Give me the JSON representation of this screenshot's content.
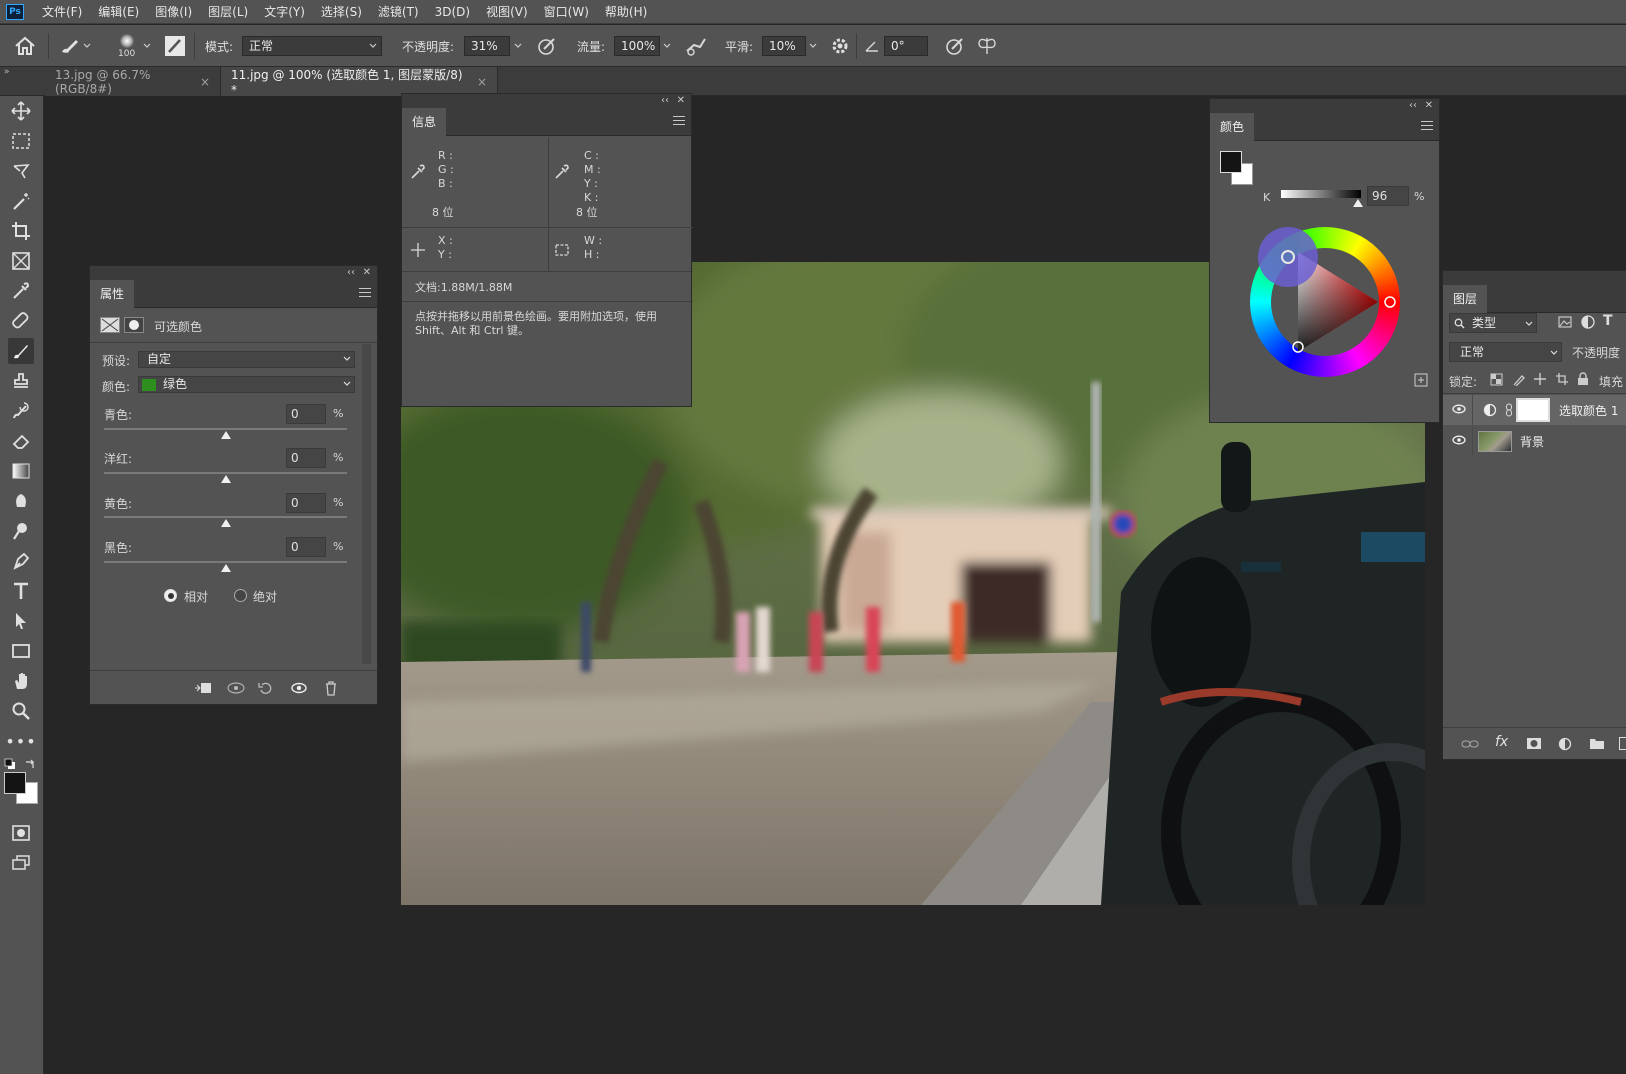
{
  "menubar": {
    "app_icon": "Ps",
    "items": [
      "文件(F)",
      "编辑(E)",
      "图像(I)",
      "图层(L)",
      "文字(Y)",
      "选择(S)",
      "滤镜(T)",
      "3D(D)",
      "视图(V)",
      "窗口(W)",
      "帮助(H)"
    ]
  },
  "options": {
    "brush_size": "100",
    "mode_label": "模式:",
    "mode_value": "正常",
    "opacity_label": "不透明度:",
    "opacity_value": "31%",
    "flow_label": "流量:",
    "flow_value": "100%",
    "smooth_label": "平滑:",
    "smooth_value": "10%",
    "angle_value": "0°"
  },
  "tabs": [
    {
      "label": "13.jpg @ 66.7%(RGB/8#)",
      "close": "×"
    },
    {
      "label": "11.jpg @ 100% (选取颜色 1, 图层蒙版/8) *",
      "close": "×"
    }
  ],
  "info_panel": {
    "title": "信息",
    "rgb_labels": [
      "R :",
      "G :",
      "B :"
    ],
    "cmyk_labels": [
      "C :",
      "M :",
      "Y :",
      "K :"
    ],
    "bits_left": "8 位",
    "bits_right": "8 位",
    "xy_labels": [
      "X :",
      "Y :"
    ],
    "wh_labels": [
      "W :",
      "H :"
    ],
    "doc_size": "文档:1.88M/1.88M",
    "hint": "点按并拖移以用前景色绘画。要用附加选项，使用 Shift、Alt 和 Ctrl 键。"
  },
  "color_panel": {
    "title": "颜色",
    "k_label": "K",
    "k_value": "96",
    "k_unit": "%",
    "foreground": "#141414",
    "background": "#ffffff"
  },
  "properties_panel": {
    "title": "属性",
    "subtitle": "可选颜色",
    "preset_label": "预设:",
    "preset_value": "自定",
    "color_label": "颜色:",
    "color_value": "绿色",
    "color_swatch": "#2e8f1e",
    "sliders": [
      {
        "label": "青色:",
        "value": "0",
        "unit": "%"
      },
      {
        "label": "洋红:",
        "value": "0",
        "unit": "%"
      },
      {
        "label": "黄色:",
        "value": "0",
        "unit": "%"
      },
      {
        "label": "黑色:",
        "value": "0",
        "unit": "%"
      }
    ],
    "radio_relative": "相对",
    "radio_absolute": "绝对",
    "selected_method": "相对"
  },
  "layers_panel": {
    "title": "图层",
    "filter_kind": "类型",
    "blend_mode": "正常",
    "opacity_label": "不透明度",
    "lock_label": "锁定:",
    "fill_label": "填充",
    "layers": [
      {
        "name": "选取颜色 1",
        "type": "adjustment"
      },
      {
        "name": "背景",
        "type": "image"
      }
    ]
  }
}
